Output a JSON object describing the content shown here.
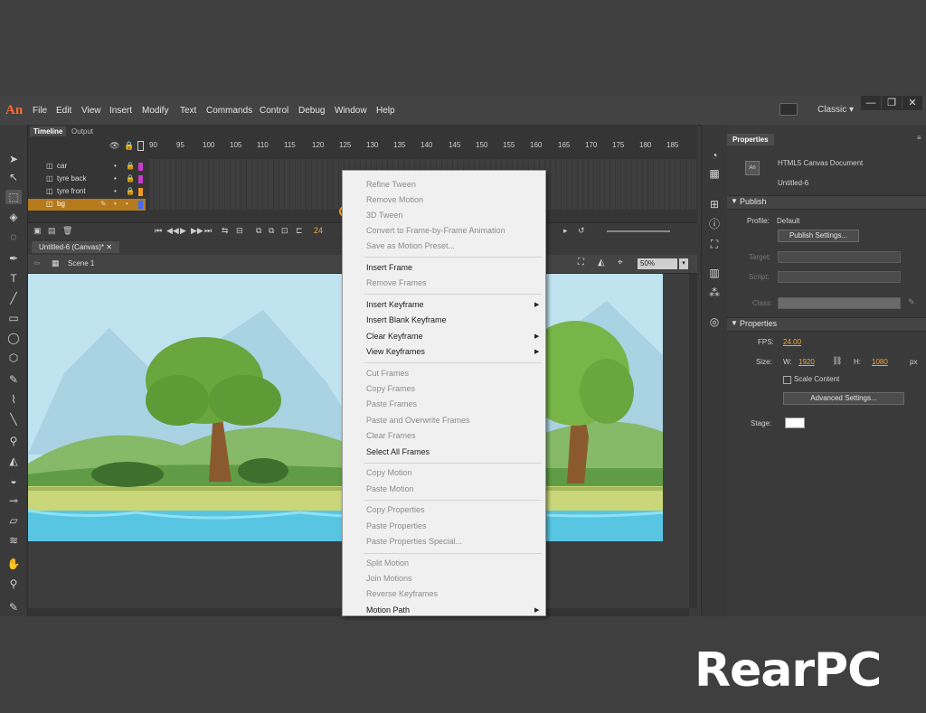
{
  "app": {
    "logo": "An",
    "workspace": "Classic",
    "window_buttons": [
      "—",
      "❐",
      "✕"
    ]
  },
  "menu": [
    "File",
    "Edit",
    "View",
    "Insert",
    "Modify",
    "Text",
    "Commands",
    "Control",
    "Debug",
    "Window",
    "Help"
  ],
  "timeline": {
    "tabs": [
      "Timeline",
      "Output"
    ],
    "ruler": [
      "90",
      "95",
      "100",
      "105",
      "110",
      "115",
      "120",
      "125",
      "130",
      "135",
      "140",
      "145",
      "150",
      "155",
      "160",
      "165",
      "170",
      "175",
      "180",
      "185"
    ],
    "layers": [
      {
        "name": "car",
        "color": "#c43ec9"
      },
      {
        "name": "tyre back",
        "color": "#c43ec9"
      },
      {
        "name": "tyre front",
        "color": "#f19a21"
      },
      {
        "name": "bg",
        "color": "#3c6cff",
        "selected": true
      }
    ],
    "frame_counter": "24"
  },
  "document": {
    "tab": "Untitled-6 (Canvas)*",
    "scene": "Scene 1",
    "zoom": "50%"
  },
  "properties": {
    "tab": "Properties",
    "doc_type": "HTML5 Canvas Document",
    "doc_name": "Untitled-6",
    "publish_header": "Publish",
    "profile_label": "Profile:",
    "profile_value": "Default",
    "publish_settings": "Publish Settings...",
    "target_label": "Target:",
    "script_label": "Script:",
    "class_label": "Class:",
    "props_header": "Properties",
    "fps_label": "FPS:",
    "fps_value": "24.00",
    "size_label": "Size:",
    "w_label": "W:",
    "w_value": "1920",
    "h_label": "H:",
    "h_value": "1080",
    "unit": "px",
    "scale_content": "Scale Content",
    "advanced_settings": "Advanced Settings...",
    "stage_label": "Stage:",
    "stage_color": "#ffffff"
  },
  "context_menu": [
    {
      "label": "Refine Tween",
      "disabled": true
    },
    {
      "label": "Remove Motion",
      "disabled": true
    },
    {
      "label": "3D Tween",
      "disabled": true
    },
    {
      "label": "Convert to Frame-by-Frame Animation",
      "disabled": true
    },
    {
      "label": "Save as Motion Preset...",
      "disabled": true
    },
    {
      "label": "Insert Frame",
      "disabled": false
    },
    {
      "label": "Remove Frames",
      "disabled": true
    },
    {
      "label": "Insert Keyframe",
      "disabled": false,
      "submenu": true
    },
    {
      "label": "Insert Blank Keyframe",
      "disabled": false
    },
    {
      "label": "Clear Keyframe",
      "disabled": false,
      "submenu": true
    },
    {
      "label": "View Keyframes",
      "disabled": false,
      "submenu": true
    },
    {
      "label": "Cut Frames",
      "disabled": true
    },
    {
      "label": "Copy Frames",
      "disabled": true
    },
    {
      "label": "Paste Frames",
      "disabled": true
    },
    {
      "label": "Paste and Overwrite Frames",
      "disabled": true
    },
    {
      "label": "Clear Frames",
      "disabled": true
    },
    {
      "label": "Select All Frames",
      "disabled": false
    },
    {
      "label": "Copy Motion",
      "disabled": true
    },
    {
      "label": "Paste Motion",
      "disabled": true
    },
    {
      "label": "Copy Properties",
      "disabled": true
    },
    {
      "label": "Paste Properties",
      "disabled": true
    },
    {
      "label": "Paste Properties Special...",
      "disabled": true
    },
    {
      "label": "Split Motion",
      "disabled": true
    },
    {
      "label": "Join Motions",
      "disabled": true
    },
    {
      "label": "Reverse Keyframes",
      "disabled": true
    },
    {
      "label": "Motion Path",
      "disabled": false,
      "submenu": true
    }
  ],
  "watermark": "RearPC"
}
